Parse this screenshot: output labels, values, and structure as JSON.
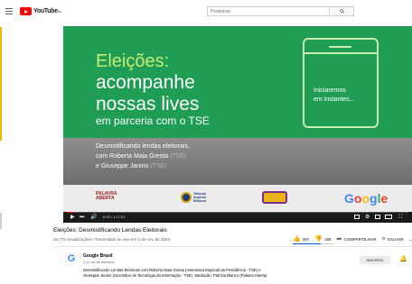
{
  "header": {
    "logo_text": "YouTube",
    "logo_country": "BR",
    "search_placeholder": "Pesquisar"
  },
  "video": {
    "headline_1": "Eleições:",
    "headline_2": "acompanhe",
    "headline_3": "nossas lives",
    "headline_4": "em parceria com o TSE",
    "phone_text_1": "Iniciaremos",
    "phone_text_2": "em instantes...",
    "speaker_line_1": "Desmistificando lendas eleitorais,",
    "speaker_line_2": "com Roberta Maia Gresta",
    "speaker_line_2_org": "(TSE)",
    "speaker_line_3": "e Giuseppe Janino",
    "speaker_line_3_org": "(TSE)",
    "sponsor_palavra_1": "PALAVRA",
    "sponsor_palavra_2": "ABERTA",
    "sponsor_tse_1": "Tribunal",
    "sponsor_tse_2": "Superior",
    "sponsor_tse_3": "Eleitoral",
    "sponsor_google": "Google",
    "progress": 0.02,
    "time": "0:00 / 1:17:21"
  },
  "info": {
    "title": "Eleições: Desmistificando Lendas Eleitorais",
    "meta": "26.775 visualizações • Transmitido ao vivo em 4 de nov. de 2020",
    "likes": "357",
    "dislikes": "158",
    "share": "COMPARTILHAR",
    "save": "SALVAR",
    "more": "...",
    "like_ratio": 0.69
  },
  "channel": {
    "avatar_letter": "G",
    "name": "Google Brasil",
    "subscribers": "1,12 mi de inscritos",
    "subscribe_label": "INSCRITO",
    "description": "Desmistificando Lendas Eleitorais com Roberta Maia Gresta (Assessora Especial da Presidência - TSE) e Giuseppe Janino (Secretário de Tecnologia da Informação - TSE). Mediação: Patrícia Blanco (Palavra Aberta)"
  },
  "colors": {
    "brand_red": "#ff0000",
    "video_green": "#1f9d55",
    "like_blue": "#065fd4"
  }
}
